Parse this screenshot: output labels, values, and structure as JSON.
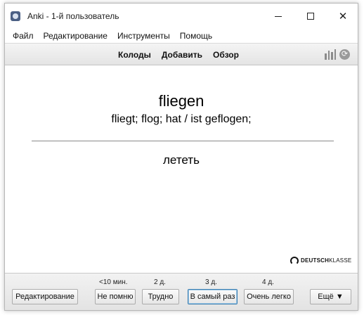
{
  "window": {
    "title": "Anki - 1-й пользователь",
    "icons": {
      "app": "anki-star-icon",
      "minimize": "minimize-icon",
      "maximize": "maximize-icon",
      "close": "close-icon",
      "close_glyph": "✕"
    }
  },
  "menu": {
    "items": [
      {
        "label": "Файл"
      },
      {
        "label": "Редактирование"
      },
      {
        "label": "Инструменты"
      },
      {
        "label": "Помощь"
      }
    ]
  },
  "toolbar": {
    "links": [
      {
        "label": "Колоды"
      },
      {
        "label": "Добавить"
      },
      {
        "label": "Обзор"
      }
    ],
    "icons": {
      "stats": "bar-chart-icon",
      "sync": "sync-icon",
      "sync_glyph": "⟳"
    }
  },
  "card": {
    "front_word": "fliegen",
    "front_forms": "fliegt; flog; hat / ist geflogen;",
    "back_word": "лететь",
    "brand": {
      "bold": "DEUTSCH",
      "light": "KLASSE",
      "icon": "headset-icon"
    }
  },
  "review": {
    "edit_label": "Редактирование",
    "answers": [
      {
        "interval": "<10 мин.",
        "label": "Не помню"
      },
      {
        "interval": "2 д.",
        "label": "Трудно"
      },
      {
        "interval": "3 д.",
        "label": "В самый раз"
      },
      {
        "interval": "4 д.",
        "label": "Очень легко"
      }
    ],
    "more_label": "Ещё ▼"
  },
  "colors": {
    "accent_focus": "#3c7fb1",
    "toolbar_bg": "#e9e9e9"
  }
}
